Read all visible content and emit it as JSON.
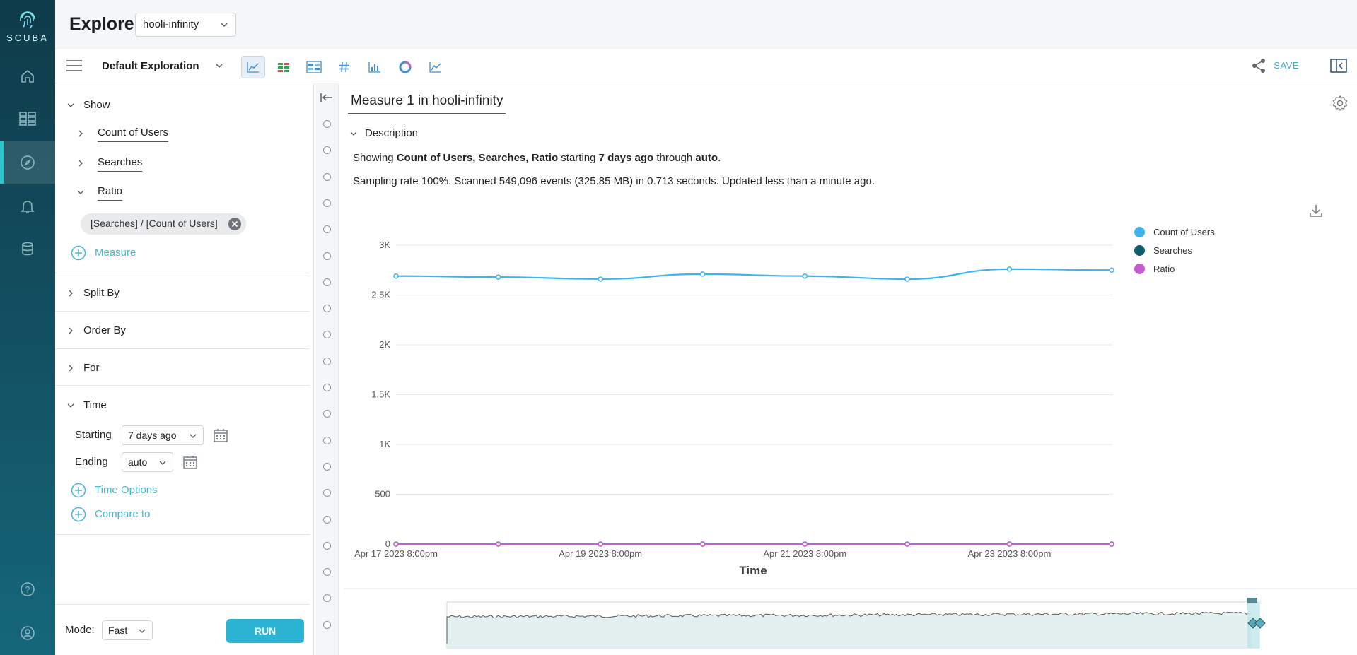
{
  "app": {
    "logo_text": "SCUBA",
    "title": "Explore",
    "dataset": "hooli-infinity"
  },
  "nav": {
    "items": [
      {
        "name": "home-icon",
        "active": false
      },
      {
        "name": "boards-icon",
        "active": false
      },
      {
        "name": "explore-compass-icon",
        "active": true
      },
      {
        "name": "alerts-bell-icon",
        "active": false
      },
      {
        "name": "database-icon",
        "active": false
      }
    ],
    "bottom": [
      {
        "name": "help-icon"
      },
      {
        "name": "account-icon"
      }
    ]
  },
  "toolbar": {
    "exploration_name": "Default Exploration",
    "save_label": "SAVE",
    "viz_types": [
      "line-chart-icon",
      "table-icon",
      "heatmap-icon",
      "number-icon",
      "bar-chart-icon",
      "pie-chart-icon",
      "area-chart-icon"
    ]
  },
  "query": {
    "show_label": "Show",
    "measures": [
      {
        "label": "Count of Users",
        "expanded": false
      },
      {
        "label": "Searches",
        "expanded": false
      },
      {
        "label": "Ratio",
        "expanded": true
      }
    ],
    "ratio_formula": "[Searches] / [Count of Users]",
    "add_measure_label": "Measure",
    "split_by_label": "Split By",
    "order_by_label": "Order By",
    "for_label": "For",
    "time_label": "Time",
    "starting_label": "Starting",
    "starting_value": "7 days ago",
    "ending_label": "Ending",
    "ending_value": "auto",
    "time_options_label": "Time Options",
    "compare_to_label": "Compare to",
    "mode_label": "Mode:",
    "mode_value": "Fast",
    "run_label": "RUN"
  },
  "main": {
    "title": "Measure 1 in hooli-infinity",
    "description_label": "Description",
    "desc": {
      "showing": "Showing ",
      "measures": "Count of Users, Searches, Ratio",
      "starting": " starting ",
      "start_value": "7 days ago",
      "through": " through ",
      "end_value": "auto",
      "period": "."
    },
    "stats": "Sampling rate 100%. Scanned 549,096 events (325.85 MB) in 0.713 seconds. Updated less than a minute ago."
  },
  "chart_data": {
    "type": "line",
    "xlabel": "Time",
    "ylabel": "",
    "ylim": [
      0,
      3000
    ],
    "yticks": [
      0,
      500,
      1000,
      1500,
      2000,
      2500,
      3000
    ],
    "ytick_labels": [
      "0",
      "500",
      "1K",
      "1.5K",
      "2K",
      "2.5K",
      "3K"
    ],
    "x": [
      "Apr 17 2023 8:00pm",
      "Apr 18 2023 8:00pm",
      "Apr 19 2023 8:00pm",
      "Apr 20 2023 8:00pm",
      "Apr 21 2023 8:00pm",
      "Apr 22 2023 8:00pm",
      "Apr 23 2023 8:00pm",
      "Apr 24 2023 8:00pm"
    ],
    "x_tick_labels": [
      "Apr 17 2023 8:00pm",
      "",
      "Apr 19 2023 8:00pm",
      "",
      "Apr 21 2023 8:00pm",
      "",
      "Apr 23 2023 8:00pm",
      ""
    ],
    "series": [
      {
        "name": "Count of Users",
        "color": "#3db4ee",
        "values": [
          2690,
          2680,
          2660,
          2710,
          2690,
          2660,
          2760,
          2750
        ]
      },
      {
        "name": "Searches",
        "color": "#0f5b6b",
        "values": [
          0,
          0,
          0,
          0,
          0,
          0,
          0,
          0
        ]
      },
      {
        "name": "Ratio",
        "color": "#c45bd0",
        "values": [
          0,
          0,
          0,
          0,
          0,
          0,
          0,
          0
        ]
      }
    ],
    "grid": true,
    "legend_position": "right"
  }
}
